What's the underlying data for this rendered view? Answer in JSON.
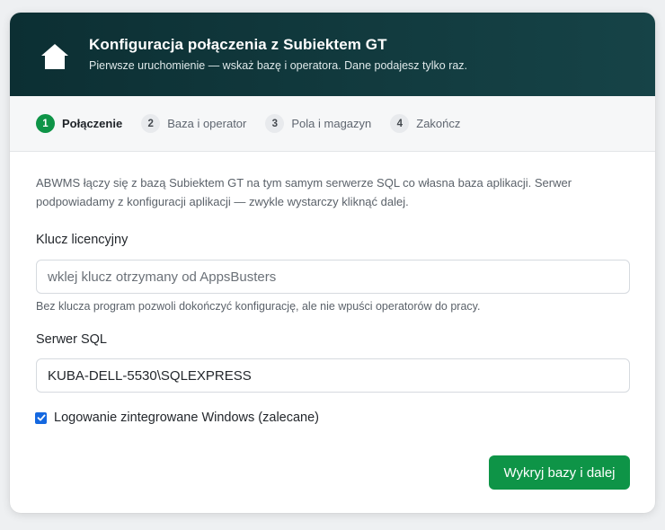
{
  "header": {
    "icon": "home-icon",
    "title": "Konfiguracja połączenia z Subiektem GT",
    "subtitle": "Pierwsze uruchomienie — wskaż bazę i operatora. Dane podajesz tylko raz."
  },
  "steps": [
    {
      "num": "1",
      "label": "Połączenie",
      "active": true
    },
    {
      "num": "2",
      "label": "Baza i operator",
      "active": false
    },
    {
      "num": "3",
      "label": "Pola i magazyn",
      "active": false
    },
    {
      "num": "4",
      "label": "Zakończ",
      "active": false
    }
  ],
  "intro": {
    "line1": "ABWMS łączy się z bazą Subiektem GT na tym samym serwerze SQL co własna baza aplikacji. Serwer",
    "line2": "podpowiadamy z konfiguracji aplikacji — zwykle wystarczy kliknąć dalej."
  },
  "license": {
    "label": "Klucz licencyjny",
    "placeholder": "wklej klucz otrzymany od AppsBusters",
    "value": "",
    "hint": "Bez klucza program pozwoli dokończyć konfigurację, ale nie wpuści operatorów do pracy."
  },
  "server": {
    "label": "Serwer SQL",
    "value": "KUBA-DELL-5530\\SQLEXPRESS"
  },
  "integrated_login": {
    "label": "Logowanie zintegrowane Windows (zalecane)",
    "checked": true
  },
  "actions": {
    "next_label": "Wykryj bazy i dalej"
  },
  "colors": {
    "header_bg": "#0c2f33",
    "accent": "#0e9447",
    "checkbox": "#1468e0"
  }
}
